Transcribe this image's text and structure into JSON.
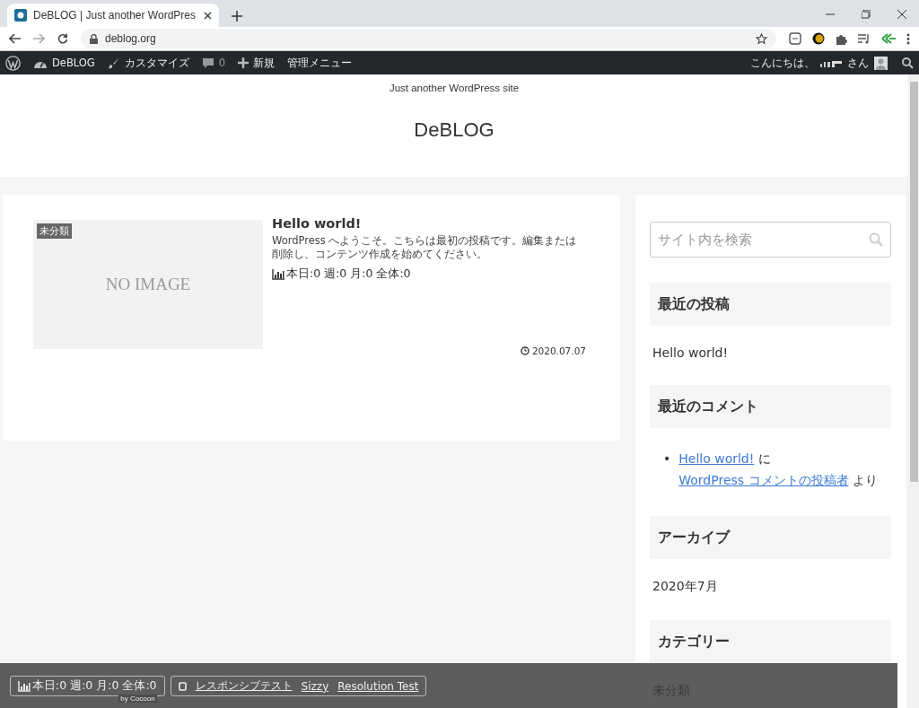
{
  "browser": {
    "tab_title": "DeBLOG | Just another WordPres",
    "url": "deblog.org"
  },
  "admin_bar": {
    "items": [
      {
        "kind": "logo"
      },
      {
        "kind": "site",
        "label": "DeBLOG"
      },
      {
        "kind": "customize",
        "label": "カスタマイズ"
      },
      {
        "kind": "comments",
        "label": "0"
      },
      {
        "kind": "new",
        "label": "新規"
      },
      {
        "kind": "menu",
        "label": "管理メニュー"
      }
    ],
    "greeting": "こんにちは、",
    "honorific": "さん"
  },
  "header": {
    "tagline": "Just another WordPress site",
    "site_title": "DeBLOG"
  },
  "post": {
    "category": "未分類",
    "thumbnail_text": "NO IMAGE",
    "title": "Hello world!",
    "excerpt": "WordPress へようこそ。こちらは最初の投稿です。編集または削除し、コンテンツ作成を始めてください。",
    "views": "本日:0 週:0 月:0 全体:0",
    "date": "2020.07.07"
  },
  "sidebar": {
    "search": {
      "placeholder": "サイト内を検索"
    },
    "widgets": [
      {
        "title": "最近の投稿",
        "kind": "list",
        "items": [
          "Hello world!"
        ]
      },
      {
        "title": "最近のコメント",
        "kind": "comments",
        "bullet": "•",
        "parts": [
          {
            "text": "Hello world!",
            "link": true
          },
          {
            "text": " に ",
            "link": false
          },
          {
            "text": "WordPress コメントの投稿者",
            "link": true
          },
          {
            "text": " より",
            "link": false
          }
        ]
      },
      {
        "title": "アーカイブ",
        "kind": "list",
        "items": [
          "2020年7月"
        ]
      },
      {
        "title": "カテゴリー",
        "kind": "list",
        "items": [
          "未分類"
        ]
      }
    ]
  },
  "footer_bar": {
    "views": "本日:0 週:0 月:0 全体:0",
    "credit": "by Cocoon",
    "links": [
      "レスポンシブテスト",
      "Sizzy",
      "Resolution Test"
    ]
  }
}
